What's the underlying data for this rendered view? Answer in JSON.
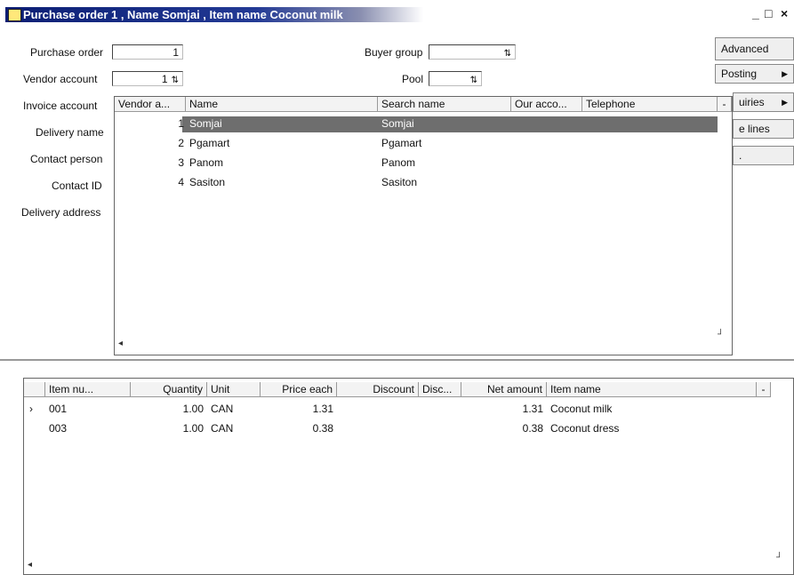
{
  "window": {
    "title": "Purchase order 1 , Name Somjai , Item name Coconut milk",
    "minimize": "_",
    "maximize": "□",
    "close": "×"
  },
  "header": {
    "purchase_order_label": "Purchase order",
    "purchase_order_value": "1",
    "vendor_account_label": "Vendor account",
    "vendor_account_value": "1",
    "invoice_account_label": "Invoice account",
    "delivery_name_label": "Delivery name",
    "contact_person_label": "Contact person",
    "contact_id_label": "Contact ID",
    "delivery_address_label": "Delivery address",
    "buyer_group_label": "Buyer group",
    "buyer_group_value": "",
    "pool_label": "Pool",
    "pool_value": ""
  },
  "side_buttons": {
    "advanced": "Advanced",
    "posting": "Posting",
    "inquiries": "uiries",
    "lines": "e lines",
    "more": "."
  },
  "lookup": {
    "columns": [
      "Vendor a...",
      "Name",
      "Search name",
      "Our acco...",
      "Telephone"
    ],
    "rows": [
      {
        "account": "1",
        "name": "Somjai",
        "search": "Somjai",
        "our": "",
        "phone": ""
      },
      {
        "account": "2",
        "name": "Pgamart",
        "search": "Pgamart",
        "our": "",
        "phone": ""
      },
      {
        "account": "3",
        "name": "Panom",
        "search": "Panom",
        "our": "",
        "phone": ""
      },
      {
        "account": "4",
        "name": "Sasiton",
        "search": "Sasiton",
        "our": "",
        "phone": ""
      }
    ],
    "selected_index": 0
  },
  "lines": {
    "columns": [
      "Item nu...",
      "Quantity",
      "Unit",
      "Price each",
      "Discount",
      "Disc...",
      "Net amount",
      "Item name"
    ],
    "rows": [
      {
        "item": "001",
        "qty": "1.00",
        "unit": "CAN",
        "price": "1.31",
        "discount": "",
        "disc": "",
        "net": "1.31",
        "name": "Coconut milk"
      },
      {
        "item": "003",
        "qty": "1.00",
        "unit": "CAN",
        "price": "0.38",
        "discount": "",
        "disc": "",
        "net": "0.38",
        "name": "Coconut dress"
      }
    ],
    "current_row_marker": "›"
  },
  "colors": {
    "title_bar": "#0b1e74",
    "selection": "#6e6e6e"
  }
}
